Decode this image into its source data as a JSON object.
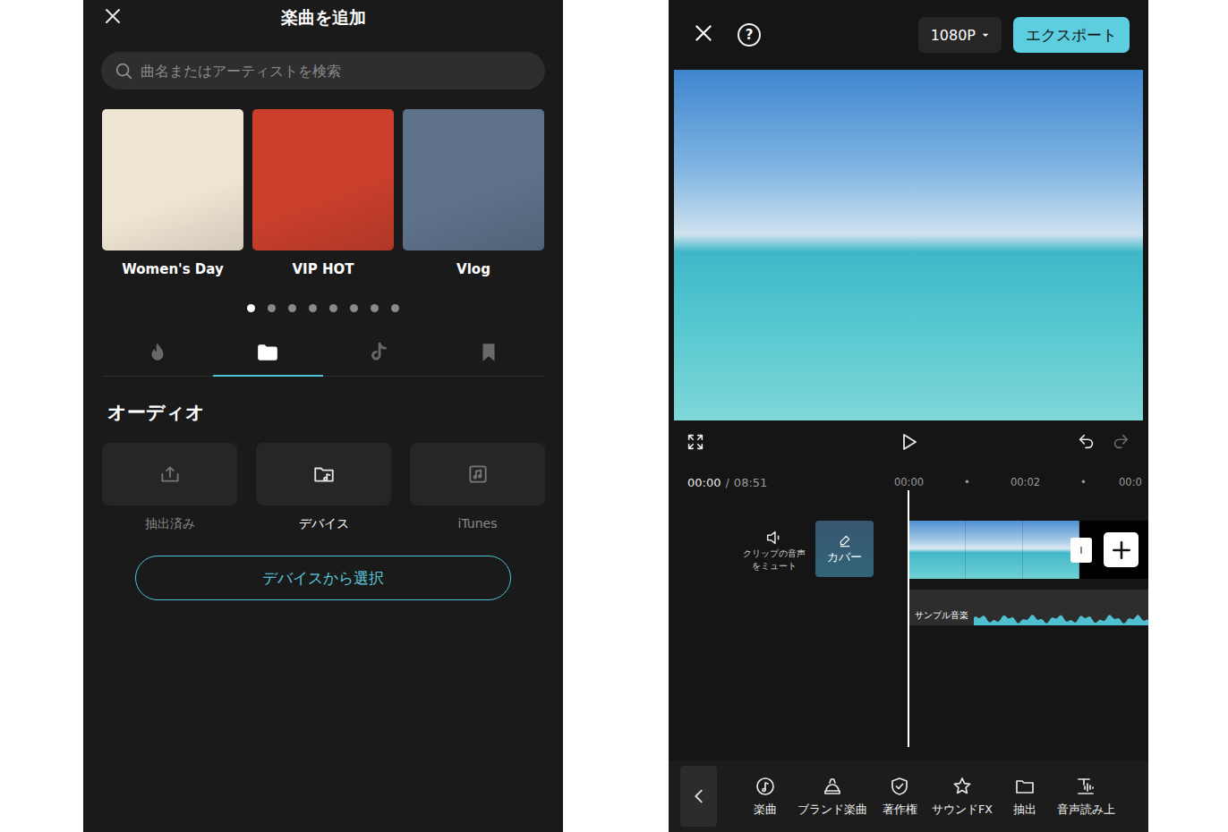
{
  "add_music": {
    "title": "楽曲を追加",
    "search": {
      "placeholder": "曲名またはアーティストを検索"
    },
    "playlists": [
      {
        "label": "Women's Day",
        "color": "#efe5d3"
      },
      {
        "label": "VIP HOT",
        "color": "#c93f2c"
      },
      {
        "label": "Vlog",
        "color": "#5d7189"
      }
    ],
    "pager": [
      {
        "selected": true
      },
      {
        "selected": false
      },
      {
        "selected": false
      },
      {
        "selected": false
      },
      {
        "selected": false
      },
      {
        "selected": false
      },
      {
        "selected": false
      },
      {
        "selected": false
      }
    ],
    "tabs": [
      {
        "kind": "trending",
        "selected": false
      },
      {
        "kind": "folder",
        "selected": true
      },
      {
        "kind": "tiktok",
        "selected": false
      },
      {
        "kind": "saved",
        "selected": false
      }
    ],
    "section_title": "オーディオ",
    "sources": [
      {
        "label": "抽出済み",
        "kind": "extracted",
        "selected": false
      },
      {
        "label": "デバイス",
        "kind": "device",
        "selected": true
      },
      {
        "label": "iTunes",
        "kind": "itunes",
        "selected": false
      }
    ],
    "select_button": "デバイスから選択"
  },
  "editor": {
    "help": "?",
    "resolution": "1080P",
    "export": "エクスポート",
    "timecode": {
      "current": "00:00",
      "separator": "/",
      "total": "08:51"
    },
    "ruler": [
      "00:00",
      "•",
      "00:02",
      "•",
      "00:0"
    ],
    "mute_label": [
      "クリップの音声",
      "をミュート"
    ],
    "cover_label": "カバー",
    "audio_track": {
      "label": "サンプル音楽"
    },
    "toolbar": [
      {
        "label": "楽曲",
        "kind": "music"
      },
      {
        "label": "ブランド楽曲",
        "kind": "brand"
      },
      {
        "label": "著作権",
        "kind": "copyright"
      },
      {
        "label": "サウンドFX",
        "kind": "soundfx"
      },
      {
        "label": "抽出",
        "kind": "extract"
      },
      {
        "label": "音声読み上",
        "kind": "tts"
      }
    ]
  }
}
